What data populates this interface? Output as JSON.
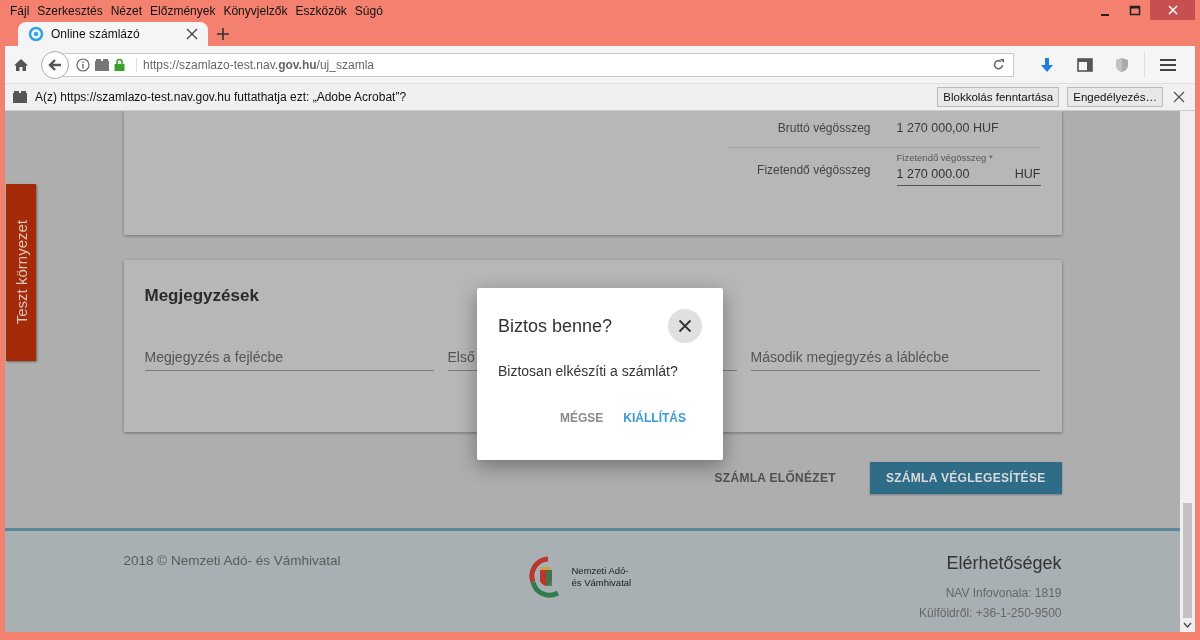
{
  "menu_bar": [
    {
      "label": "Fájl"
    },
    {
      "label": "Szerkesztés"
    },
    {
      "label": "Nézet"
    },
    {
      "label": "Előzmények"
    },
    {
      "label": "Könyvjelzők"
    },
    {
      "label": "Eszközök"
    },
    {
      "label": "Súgó"
    }
  ],
  "tab": {
    "title": "Online számlázó"
  },
  "address_bar": {
    "url": "https://szamlazo-test.nav.**gov.hu**/uj_szamla"
  },
  "plugin_bar": {
    "message": "A(z) https://szamlazo-test.nav.gov.hu futtathatja ezt: „Adobe Acrobat”?",
    "buttons": [
      "Blokkolás fenntartása",
      "Engedélyezés…"
    ]
  },
  "test_badge": "Teszt környezet",
  "totals": {
    "gross": {
      "label": "Bruttó végösszeg",
      "value": "1 270 000,00 HUF"
    },
    "payable": {
      "label": "Fizetendő végösszeg",
      "field_label": "Fizetendő végösszeg *",
      "value": "1 270 000.00",
      "suffix": "HUF"
    }
  },
  "notes": {
    "title": "Megjegyzések",
    "fields": [
      {
        "placeholder": "Megjegyzés a fejlécbe"
      },
      {
        "placeholder": "Első"
      },
      {
        "placeholder": "Második megjegyzés a láblécbe"
      }
    ]
  },
  "actions": [
    {
      "label": "SZÁMLA ELŐNÉZET",
      "kind": "flat"
    },
    {
      "label": "SZÁMLA VÉGLEGESÍTÉSE",
      "kind": "raised"
    }
  ],
  "dialog": {
    "title": "Biztos benne?",
    "message": "Biztosan elkészíti a számlát?",
    "buttons": [
      {
        "label": "MÉGSE",
        "kind": "cancel"
      },
      {
        "label": "KIÁLLÍTÁS",
        "kind": "primary"
      }
    ]
  },
  "footer": {
    "copyright": "2018 © Nemzeti Adó- és Vámhivatal",
    "logo_text": [
      "Nemzeti Adó-",
      "és Vámhivatal"
    ],
    "contact_title": "Elérhetőségek",
    "contact_lines": [
      "NAV Infovonala: 1819",
      "Külföldről: +36-1-250-9500"
    ]
  }
}
